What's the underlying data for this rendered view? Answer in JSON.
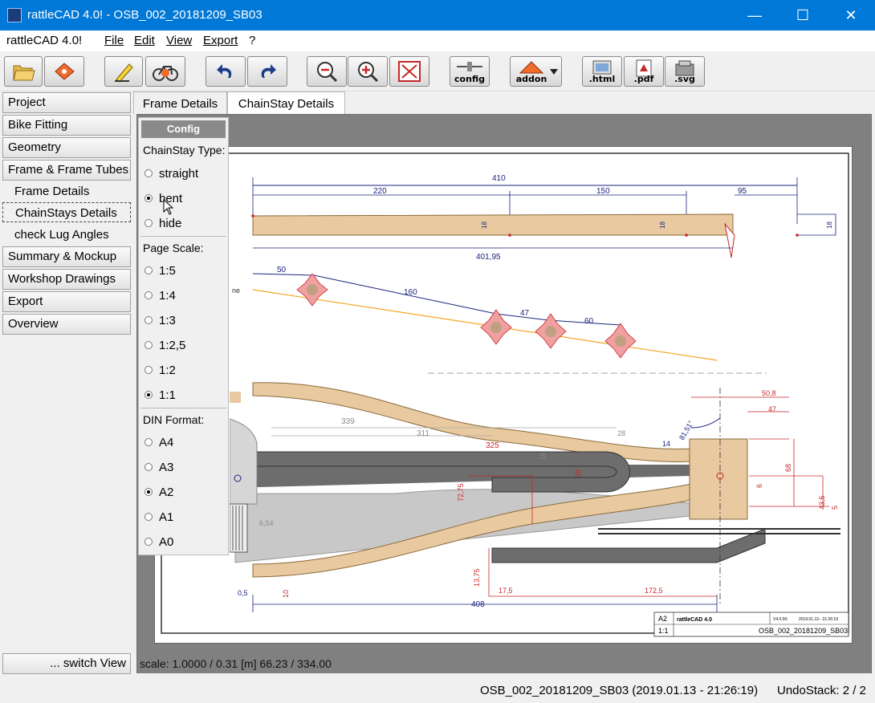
{
  "window": {
    "title": "rattleCAD 4.0!  - OSB_002_20181209_SB03",
    "minimize": "—",
    "maximize": "☐",
    "close": "✕"
  },
  "menubar": {
    "app_label": "rattleCAD 4.0!",
    "items": [
      "File",
      "Edit",
      "View",
      "Export",
      "?"
    ]
  },
  "toolbar": {
    "config_label": "config",
    "addon_label": "addon",
    "html_label": ".html",
    "pdf_label": ".pdf",
    "svg_label": ".svg"
  },
  "sidebar": {
    "items": [
      "Project",
      "Bike Fitting",
      "Geometry",
      "Frame & Frame Tubes"
    ],
    "subitems": [
      "Frame Details",
      "ChainStays Details",
      "check Lug Angles"
    ],
    "items2": [
      "Summary & Mockup",
      "Workshop Drawings",
      "Export",
      "Overview"
    ],
    "switch_view": "... switch View"
  },
  "tabs": [
    "Frame Details",
    "ChainStay Details"
  ],
  "config": {
    "header": "Config",
    "chainstay_type_label": "ChainStay Type:",
    "chainstay_types": [
      "straight",
      "bent",
      "hide"
    ],
    "chainstay_selected": "bent",
    "page_scale_label": "Page Scale:",
    "page_scales": [
      "1:5",
      "1:4",
      "1:3",
      "1:2,5",
      "1:2",
      "1:1"
    ],
    "page_scale_selected": "1:1",
    "din_format_label": "DIN Format:",
    "din_formats": [
      "A4",
      "A3",
      "A2",
      "A1",
      "A0"
    ],
    "din_selected": "A2"
  },
  "drawing": {
    "dims_top": [
      "410",
      "220",
      "150",
      "95",
      "18",
      "18",
      "18",
      "401,95"
    ],
    "dims_mid": [
      "50",
      "160",
      "47",
      "60"
    ],
    "dims_side": [
      "339",
      "311",
      "325",
      "28",
      "18",
      "28",
      "14",
      "81,51°",
      "50,8",
      "47",
      "68",
      "6",
      "43,5",
      "5",
      "72,75",
      "13,75",
      "17,5",
      "172,5",
      "408",
      "0,5",
      "10",
      "6,54"
    ],
    "titleblock": {
      "format": "A2",
      "app": "rattleCAD 4.0",
      "version": "V4.0.00-",
      "date": "2019.01.13 - 21:26:19",
      "scale": "1:1",
      "file": "OSB_002_20181209_SB03"
    },
    "side_label": "ne"
  },
  "scale_status": "scale: 1.0000 / 0.31  [m]  66.23 / 334.00",
  "statusbar": {
    "file": "OSB_002_20181209_SB03  (2019.01.13 - 21:26:19)",
    "undo": "UndoStack:  2 / 2"
  },
  "colors": {
    "titlebar": "#0078d7",
    "stay_fill": "#e8c9a0",
    "dim_blue": "#1a237e",
    "dim_red": "#c62828",
    "centerline": "#f5a623",
    "grey_part": "#6d6d6d"
  }
}
